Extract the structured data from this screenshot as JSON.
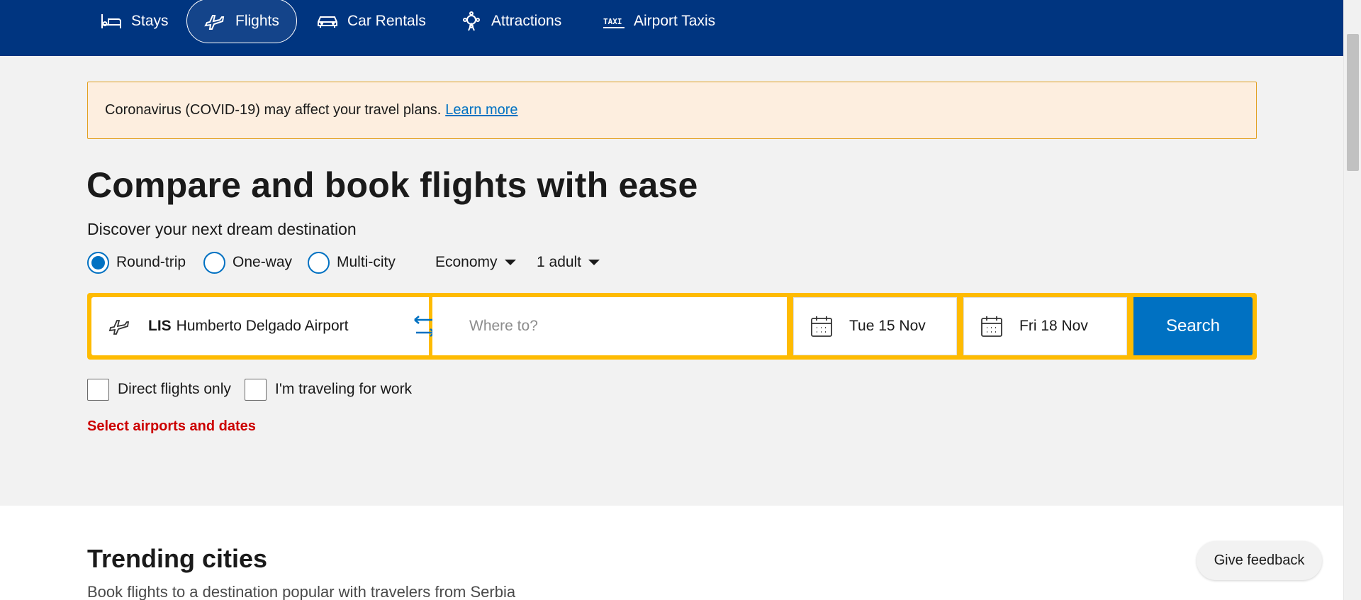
{
  "nav": {
    "items": [
      {
        "label": "Stays",
        "icon": "bed-icon"
      },
      {
        "label": "Flights",
        "icon": "plane-icon",
        "active": true
      },
      {
        "label": "Car Rentals",
        "icon": "car-icon"
      },
      {
        "label": "Attractions",
        "icon": "attractions-icon"
      },
      {
        "label": "Airport Taxis",
        "icon": "taxi-icon"
      }
    ],
    "taxi_glyph": "TAXI"
  },
  "alert": {
    "text": "Coronavirus (COVID-19) may affect your travel plans.",
    "link": "Learn more"
  },
  "hero": {
    "title": "Compare and book flights with ease",
    "subtitle": "Discover your next dream destination"
  },
  "trip_type": {
    "options": [
      "Round-trip",
      "One-way",
      "Multi-city"
    ],
    "selected": "Round-trip"
  },
  "cabin_class": {
    "selected": "Economy"
  },
  "passengers": {
    "selected": "1 adult"
  },
  "search": {
    "from_code": "LIS",
    "from_name": "Humberto Delgado Airport",
    "to_placeholder": "Where to?",
    "depart_date": "Tue 15 Nov",
    "return_date": "Fri 18 Nov",
    "button": "Search"
  },
  "filters": {
    "direct_only": "Direct flights only",
    "work_travel": "I'm traveling for work"
  },
  "validation": {
    "message": "Select airports and dates"
  },
  "trending": {
    "title": "Trending cities",
    "subtitle": "Book flights to a destination popular with travelers from Serbia"
  },
  "feedback": {
    "label": "Give feedback"
  },
  "colors": {
    "nav_bg": "#003580",
    "accent_blue": "#0071c2",
    "search_border": "#febb02",
    "alert_bg": "#fdeedf",
    "alert_border": "#e2a122",
    "error": "#cc0000"
  }
}
